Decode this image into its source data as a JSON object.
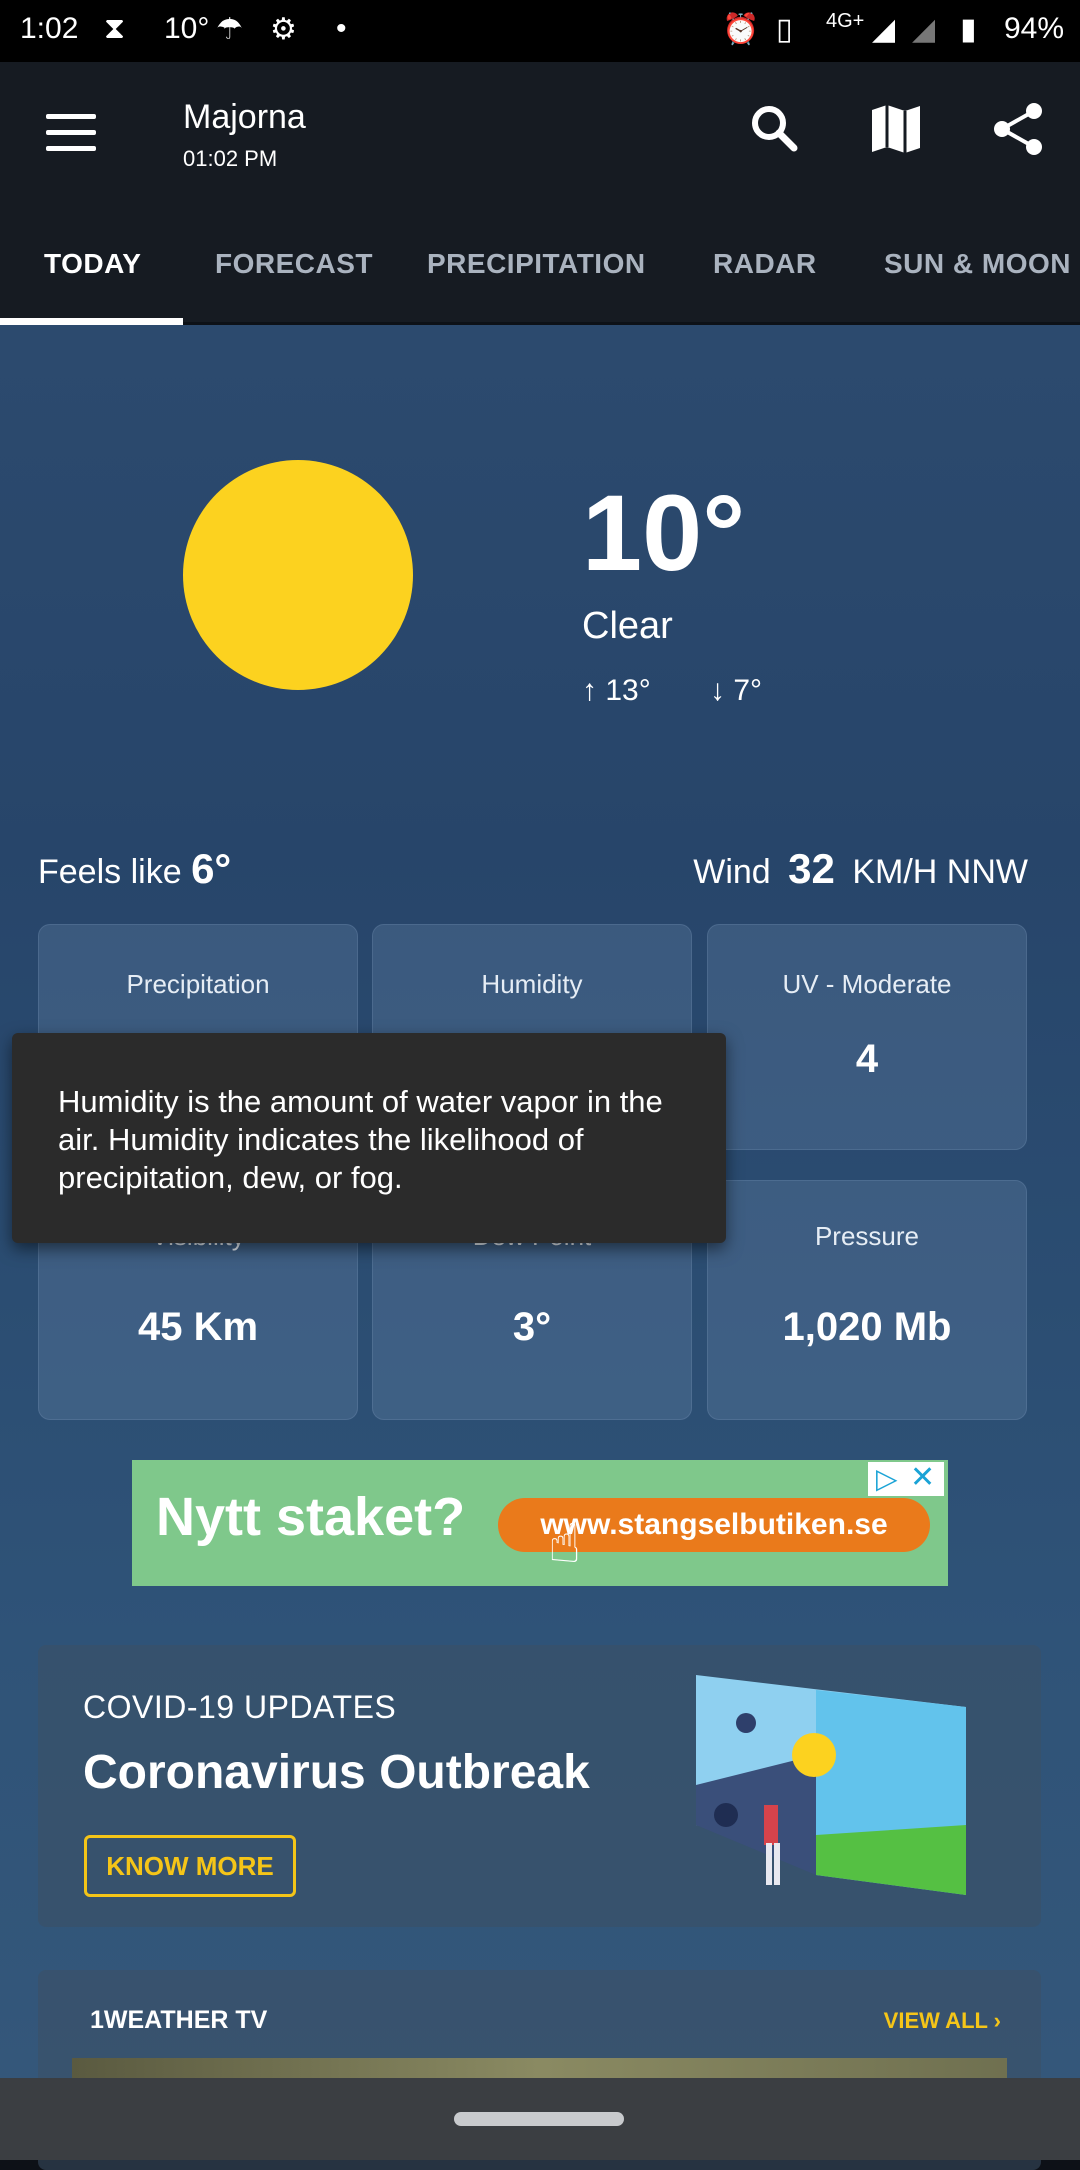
{
  "status_bar": {
    "time": "1:02",
    "temp": "10°",
    "network": "4G+",
    "battery": "94%"
  },
  "header": {
    "location": "Majorna",
    "time": "01:02 PM"
  },
  "tabs": [
    {
      "label": "TODAY",
      "active": true
    },
    {
      "label": "FORECAST"
    },
    {
      "label": "PRECIPITATION"
    },
    {
      "label": "RADAR"
    },
    {
      "label": "SUN & MOON"
    }
  ],
  "current": {
    "temperature": "10°",
    "condition": "Clear",
    "high": "13°",
    "low": "7°",
    "feels_like_label": "Feels like",
    "feels_like_value": "6°",
    "wind_label": "Wind",
    "wind_speed": "32",
    "wind_unit_dir": "KM/H NNW"
  },
  "cards": [
    {
      "label": "Precipitation"
    },
    {
      "label": "Humidity"
    },
    {
      "label": "UV - Moderate",
      "value": "4"
    },
    {
      "label": "Visibility",
      "value": "45 Km"
    },
    {
      "label": "Dew Point",
      "value": "3°"
    },
    {
      "label": "Pressure",
      "value": "1,020 Mb"
    }
  ],
  "tooltip": {
    "text": "Humidity is the amount of water vapor in the air. Humidity indicates the likelihood of precipitation, dew, or fog."
  },
  "ad": {
    "headline": "Nytt staket?",
    "url": "www.stangselbutiken.se"
  },
  "covid": {
    "kicker": "COVID-19 UPDATES",
    "title": "Coronavirus Outbreak",
    "button": "KNOW MORE"
  },
  "tv": {
    "title": "1WEATHER TV",
    "view_all": "VIEW ALL"
  },
  "colors": {
    "sun": "#fcd21f",
    "accent": "#f5c518",
    "ad_bg": "#7fc88b",
    "ad_pill": "#ea7a1b"
  }
}
